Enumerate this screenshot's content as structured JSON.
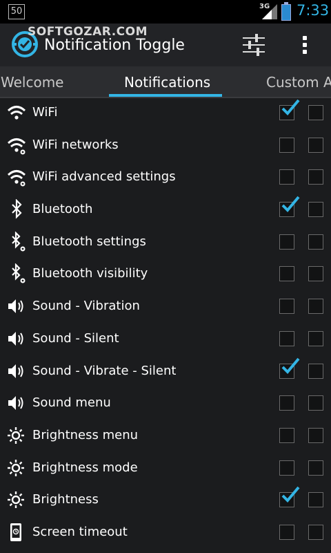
{
  "status": {
    "notification_badge": "50",
    "network": "3G",
    "clock": "7:33"
  },
  "watermark": "SOFTGOZAR.COM",
  "app": {
    "title": "Notification Toggle"
  },
  "icons": {
    "app": "notification-toggle-app-icon",
    "settings": "sliders-icon",
    "overflow": "overflow-menu-icon"
  },
  "tabs": [
    {
      "label": "Welcome"
    },
    {
      "label": "Notifications"
    },
    {
      "label": "Custom A"
    }
  ],
  "active_tab": "Notifications",
  "accent_color": "#33b5e5",
  "items": [
    {
      "label": "WiFi",
      "icon": "wifi-icon",
      "checked": true,
      "checked2": false
    },
    {
      "label": "WiFi networks",
      "icon": "wifi-settings-icon",
      "checked": false,
      "checked2": false
    },
    {
      "label": "WiFi advanced settings",
      "icon": "wifi-settings-icon",
      "checked": false,
      "checked2": false
    },
    {
      "label": "Bluetooth",
      "icon": "bluetooth-icon",
      "checked": true,
      "checked2": false
    },
    {
      "label": "Bluetooth settings",
      "icon": "bluetooth-settings-icon",
      "checked": false,
      "checked2": false
    },
    {
      "label": "Bluetooth visibility",
      "icon": "bluetooth-settings-icon",
      "checked": false,
      "checked2": false
    },
    {
      "label": "Sound - Vibration",
      "icon": "speaker-icon",
      "checked": false,
      "checked2": false
    },
    {
      "label": "Sound - Silent",
      "icon": "speaker-icon",
      "checked": false,
      "checked2": false
    },
    {
      "label": "Sound - Vibrate - Silent",
      "icon": "speaker-icon",
      "checked": true,
      "checked2": false
    },
    {
      "label": "Sound menu",
      "icon": "speaker-icon",
      "checked": false,
      "checked2": false
    },
    {
      "label": "Brightness menu",
      "icon": "brightness-icon",
      "checked": false,
      "checked2": false
    },
    {
      "label": "Brightness mode",
      "icon": "brightness-icon",
      "checked": false,
      "checked2": false
    },
    {
      "label": "Brightness",
      "icon": "brightness-icon",
      "checked": true,
      "checked2": false
    },
    {
      "label": "Screen timeout",
      "icon": "screen-timeout-icon",
      "checked": false,
      "checked2": false
    }
  ]
}
